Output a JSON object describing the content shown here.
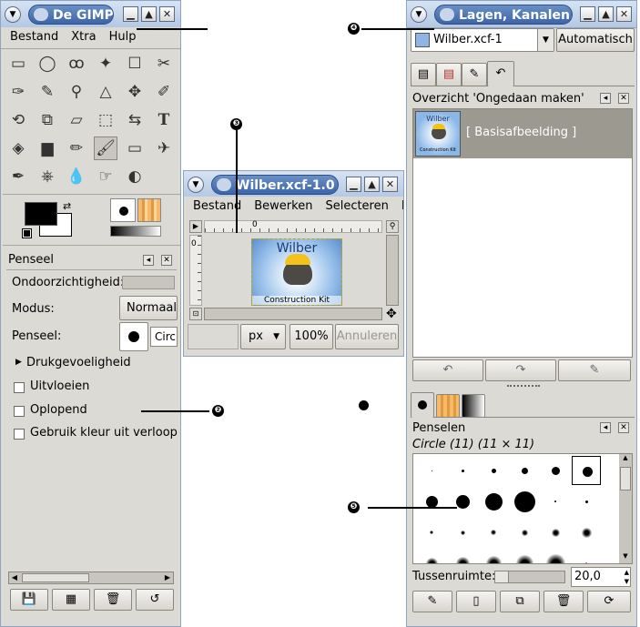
{
  "toolbox": {
    "title": "De GIMP",
    "menu": [
      "Bestand",
      "Xtra",
      "Hulp"
    ],
    "tool_icons": [
      "rect-select-icon",
      "ellipse-select-icon",
      "lasso-icon",
      "magic-wand-icon",
      "color-select-icon",
      "scissors-icon",
      "paths-icon",
      "color-picker-icon",
      "zoom-icon",
      "measure-icon",
      "move-icon",
      "crop-icon",
      "rotate-icon",
      "scale-icon",
      "shear-icon",
      "perspective-icon",
      "flip-icon",
      "text-icon",
      "bucket-fill-icon",
      "blend-icon",
      "pencil-icon",
      "paintbrush-icon",
      "eraser-icon",
      "airbrush-icon",
      "ink-icon",
      "clone-icon",
      "blur-icon",
      "smudge-icon",
      "dodge-burn-icon"
    ],
    "text_tool_glyph": "T"
  },
  "tool_options": {
    "title": "Penseel",
    "opacity_label": "Ondoorzichtigheid:",
    "mode_label": "Modus:",
    "mode_value": "Normaal",
    "brush_label": "Penseel:",
    "brush_value": "Circ",
    "pressure_label": "Drukgevoeligheid",
    "fade_label": "Uitvloeien",
    "incremental_label": "Oplopend",
    "gradient_label": "Gebruik kleur uit verloop"
  },
  "image_window": {
    "title": "Wilber.xcf-1.0 (",
    "menu": [
      "Bestand",
      "Bewerken",
      "Selecteren",
      "B"
    ],
    "ruler_zero": "0",
    "ruler_v_zero": "0",
    "image_title": "Wilber",
    "image_subtitle": "Construction Kit",
    "unit": "px",
    "zoom": "100%",
    "cancel": "Annuleren"
  },
  "layers_window": {
    "title": "Lagen, Kanalen,",
    "image_select": "Wilber.xcf-1",
    "auto_button": "Automatisch",
    "undo_title": "Overzicht 'Ongedaan maken'",
    "undo_item": "[ Basisafbeelding ]",
    "thumb_title": "Wilber",
    "thumb_subtitle": "Construction Kit"
  },
  "brushes": {
    "title": "Penselen",
    "current": "Circle (11) (11 × 11)",
    "spacing_label": "Tussenruimte:",
    "spacing_value": "20,0",
    "spacing_fraction": 0.2
  },
  "callouts": {
    "c2": "❷",
    "c3": "❸",
    "c4": "❹",
    "c5": "❺"
  }
}
